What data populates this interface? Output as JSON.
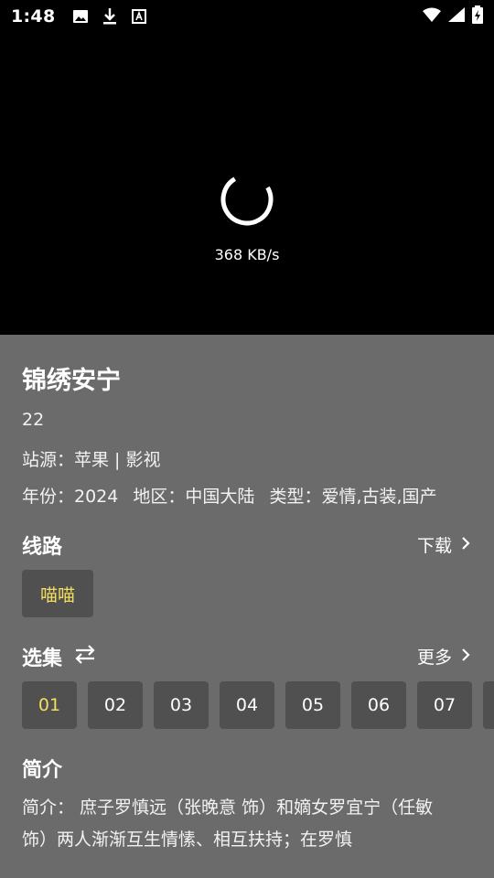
{
  "status_bar": {
    "time": "1:48",
    "icons": [
      "image-icon",
      "download-icon",
      "a-badge-icon",
      "wifi-icon",
      "signal-icon",
      "battery-icon"
    ]
  },
  "player": {
    "speed": "368 KB/s"
  },
  "details": {
    "title": "锦绣安宁",
    "episode_count": "22",
    "source": "站源：苹果 | 影视",
    "year": "年份：2024",
    "region": "地区：中国大陆",
    "genre": "类型：爱情,古装,国产"
  },
  "route": {
    "heading": "线路",
    "download_label": "下载",
    "options": [
      "喵喵"
    ],
    "selected": "喵喵"
  },
  "episodes": {
    "heading": "选集",
    "more_label": "更多",
    "items": [
      "01",
      "02",
      "03",
      "04",
      "05",
      "06",
      "07",
      ""
    ],
    "selected": "01"
  },
  "intro": {
    "heading": "简介",
    "text": "简介：        庶子罗慎远（张晚意 饰）和嫡女罗宜宁（任敏 饰）两人渐渐互生情愫、相互扶持；在罗慎"
  },
  "colors": {
    "accent": "#f4de5d",
    "panel": "#6b6b6b",
    "chip": "#505050"
  }
}
